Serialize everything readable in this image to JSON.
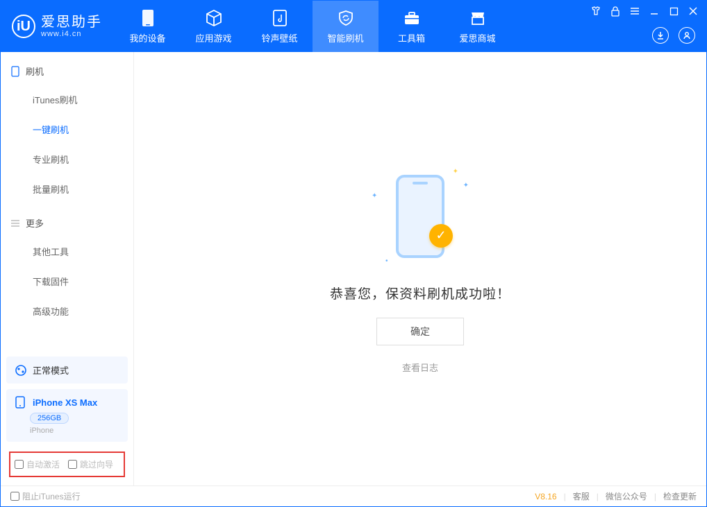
{
  "app": {
    "name": "爱思助手",
    "url": "www.i4.cn"
  },
  "nav": [
    {
      "label": "我的设备"
    },
    {
      "label": "应用游戏"
    },
    {
      "label": "铃声壁纸"
    },
    {
      "label": "智能刷机"
    },
    {
      "label": "工具箱"
    },
    {
      "label": "爱思商城"
    }
  ],
  "sidebar": {
    "group1": {
      "title": "刷机",
      "items": [
        "iTunes刷机",
        "一键刷机",
        "专业刷机",
        "批量刷机"
      ]
    },
    "group2": {
      "title": "更多",
      "items": [
        "其他工具",
        "下载固件",
        "高级功能"
      ]
    }
  },
  "mode_card": {
    "label": "正常模式"
  },
  "device_card": {
    "name": "iPhone XS Max",
    "storage": "256GB",
    "type": "iPhone"
  },
  "options": {
    "auto_activate": "自动激活",
    "skip_guide": "跳过向导"
  },
  "main": {
    "success_text": "恭喜您，保资料刷机成功啦！",
    "ok": "确定",
    "view_log": "查看日志"
  },
  "footer": {
    "block_itunes": "阻止iTunes运行",
    "version": "V8.16",
    "support": "客服",
    "wechat": "微信公众号",
    "update": "检查更新"
  }
}
